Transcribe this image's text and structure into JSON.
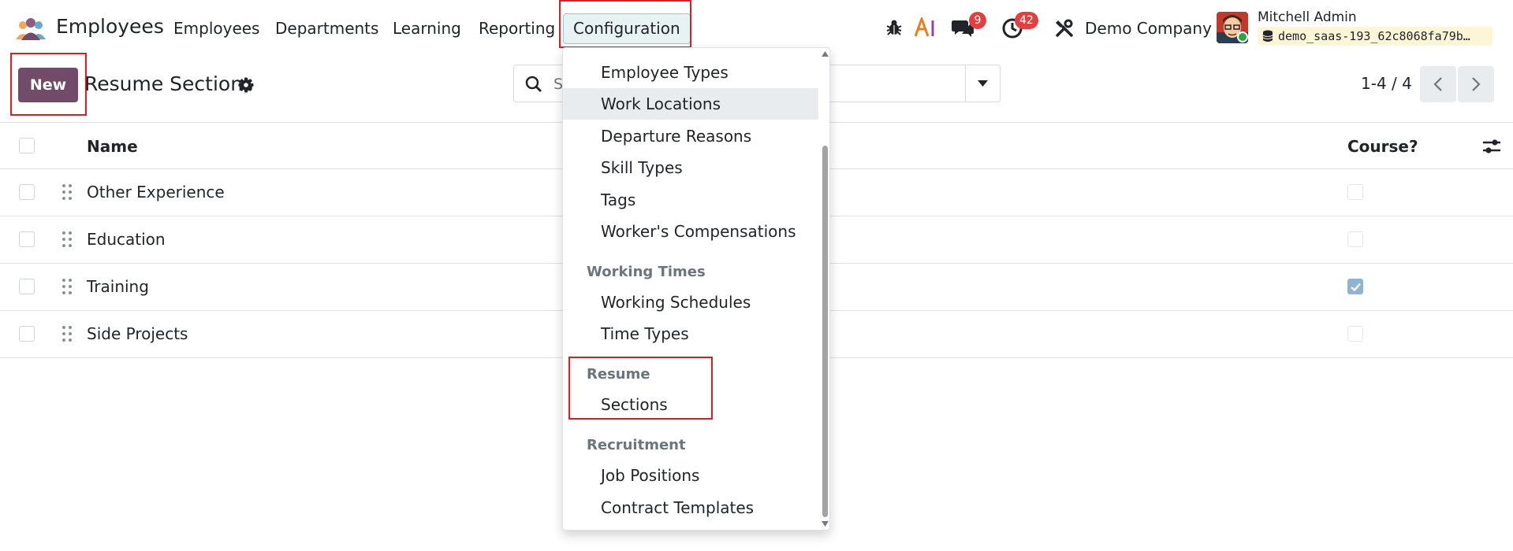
{
  "navbar": {
    "app_name": "Employees",
    "menu": [
      "Employees",
      "Departments",
      "Learning",
      "Reporting"
    ],
    "active_menu": "Configuration",
    "messages_count": "9",
    "activities_count": "42",
    "company": "Demo Company",
    "user_name": "Mitchell Admin",
    "database": "demo_saas-193_62c8068fa79b…"
  },
  "control_panel": {
    "new_label": "New",
    "title": "Resume Sections",
    "search_placeholder": "Search...",
    "pager": "1-4 / 4"
  },
  "list": {
    "columns": [
      "Name",
      "Course?"
    ],
    "rows": [
      {
        "name": "Other Experience",
        "course": false
      },
      {
        "name": "Education",
        "course": false
      },
      {
        "name": "Training",
        "course": true
      },
      {
        "name": "Side Projects",
        "course": false
      }
    ]
  },
  "dropdown": {
    "items_top": [
      "Employee Types",
      "Work Locations",
      "Departure Reasons",
      "Skill Types",
      "Tags",
      "Worker's Compensations"
    ],
    "working_times_header": "Working Times",
    "working_times_items": [
      "Working Schedules",
      "Time Types"
    ],
    "resume_header": "Resume",
    "resume_items": [
      "Sections"
    ],
    "recruitment_header": "Recruitment",
    "recruitment_items": [
      "Job Positions",
      "Contract Templates"
    ]
  },
  "colors": {
    "brand": "#714b67",
    "badge": "#e0403f",
    "highlight": "#e01b24",
    "checked": "#8fb4cf"
  }
}
